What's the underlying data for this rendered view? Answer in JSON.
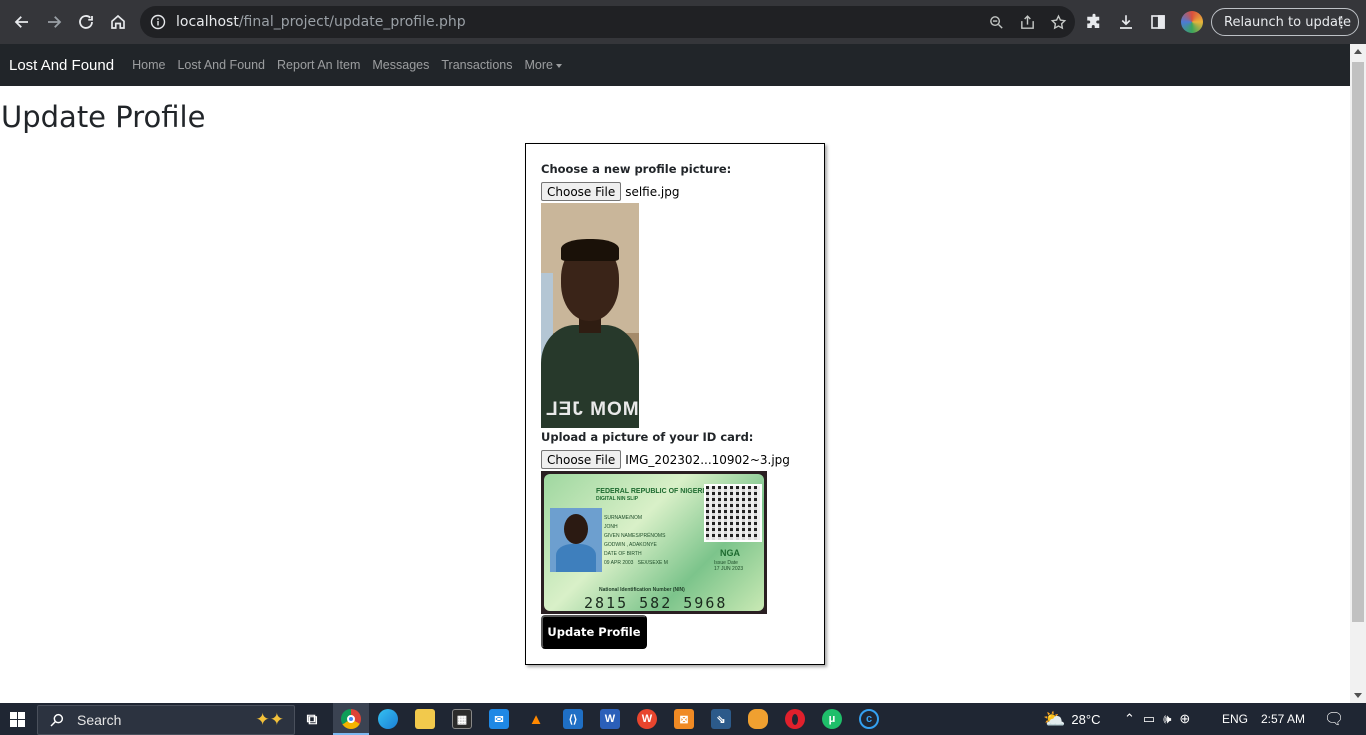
{
  "browser": {
    "url_host": "localhost",
    "url_path": "/final_project/update_profile.php",
    "relaunch_label": "Relaunch to update"
  },
  "navbar": {
    "brand": "Lost And Found",
    "links": [
      "Home",
      "Lost And Found",
      "Report An Item",
      "Messages",
      "Transactions"
    ],
    "more_label": "More"
  },
  "page": {
    "title": "Update Profile"
  },
  "form": {
    "profile_label": "Choose a new profile picture:",
    "profile_button": "Choose File",
    "profile_file": "selfie.jpg",
    "id_label": "Upload a picture of your ID card:",
    "id_button": "Choose File",
    "id_file": "IMG_202302...10902~3.jpg",
    "submit_label": "Update Profile"
  },
  "selfie_image": {
    "print_text": "MOM JEL"
  },
  "id_card_image": {
    "header": "FEDERAL REPUBLIC OF NIGERIA",
    "subheader": "DIGITAL NIN SLIP",
    "surname_label": "SURNAME/NOM",
    "surname": "JONH",
    "given_names_label": "GIVEN NAMES/PRÉNOMS",
    "given_names": "GODWIN , ADAKONYE",
    "dob_label": "DATE OF BIRTH",
    "dob": "09 APR 2003",
    "sex_label": "SEX/SEXE",
    "sex": "M",
    "country": "NGA",
    "issue_label": "Issue Date",
    "issue_date": "17 JUN 2023",
    "nin_label": "National Identification Number (NIN)",
    "nin": "2815 582 5968"
  },
  "taskbar": {
    "search_placeholder": "Search",
    "weather": "28°C",
    "language": "ENG",
    "time": "2:57 AM"
  },
  "colors": {
    "navbar_bg": "#212529",
    "chrome_bg": "#35363a",
    "button_bg": "#000000",
    "taskbar_bg": "#1f2633"
  }
}
